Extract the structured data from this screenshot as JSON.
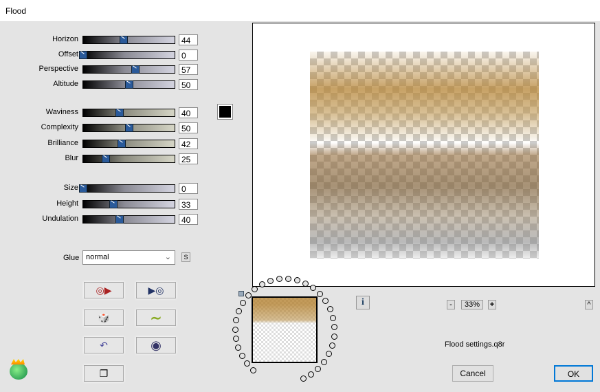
{
  "window": {
    "title": "Flood"
  },
  "sliders_group1": [
    {
      "label": "Horizon",
      "value": 44
    },
    {
      "label": "Offset",
      "value": 0
    },
    {
      "label": "Perspective",
      "value": 57
    },
    {
      "label": "Altitude",
      "value": 50
    }
  ],
  "sliders_group2": [
    {
      "label": "Waviness",
      "value": 40
    },
    {
      "label": "Complexity",
      "value": 50
    },
    {
      "label": "Brilliance",
      "value": 42
    },
    {
      "label": "Blur",
      "value": 25
    }
  ],
  "sliders_group3": [
    {
      "label": "Size",
      "value": 0
    },
    {
      "label": "Height",
      "value": 33
    },
    {
      "label": "Undulation",
      "value": 40
    }
  ],
  "color_swatch": "#000000",
  "glue": {
    "label": "Glue",
    "value": "normal",
    "s_label": "S"
  },
  "toolbar": {
    "zoom": "33%",
    "minus": "-",
    "plus": "+",
    "up": "^",
    "info": "i"
  },
  "filename": "Flood settings.q8r",
  "buttons": {
    "cancel": "Cancel",
    "ok": "OK"
  }
}
